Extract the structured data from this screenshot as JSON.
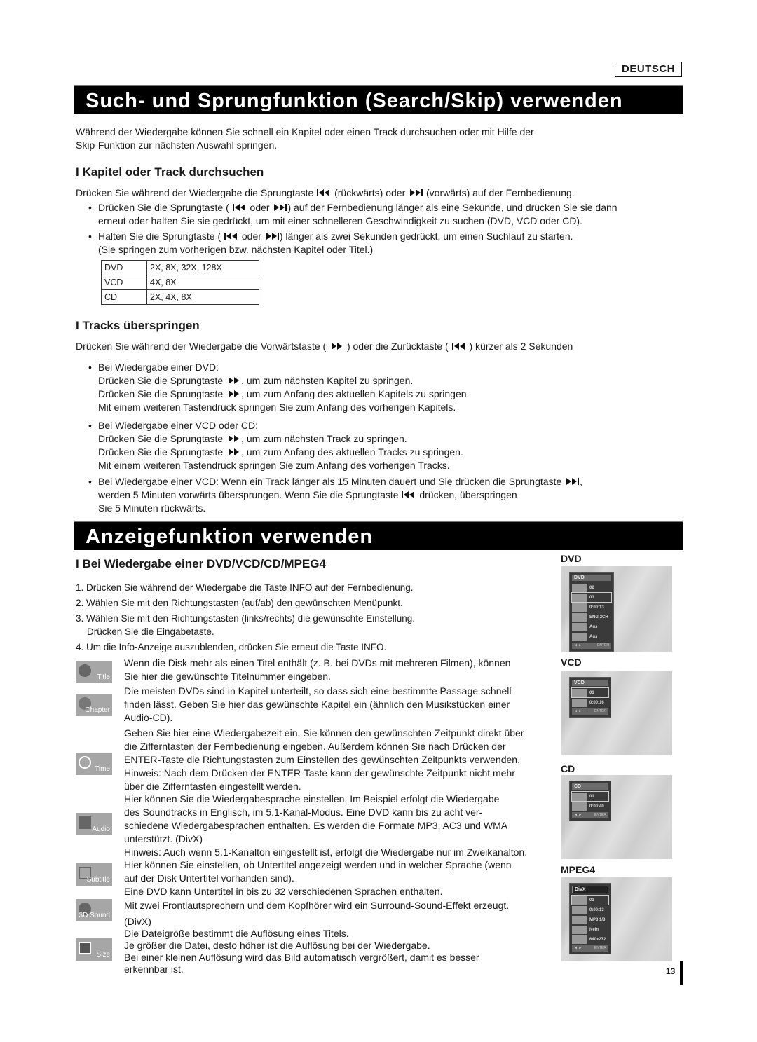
{
  "language_badge": "DEUTSCH",
  "section1": {
    "title": "Such- und Sprungfunktion (Search/Skip) verwenden",
    "intro": [
      "Während der Wiedergabe können Sie schnell ein Kapitel oder einen Track durchsuchen oder mit Hilfe der",
      "Skip-Funktion zur nächsten Auswahl springen."
    ],
    "sub1": {
      "heading": "I Kapitel oder Track durchsuchen",
      "line1_a": "Drücken Sie während der Wiedergabe die Sprungtaste",
      "line1_b": "(rückwärts) oder",
      "line1_c": "(vorwärts) auf der Fernbedienung.",
      "b1_a": "Drücken Sie die Sprungtaste (",
      "b1_b": "oder",
      "b1_c": ") auf der Fernbedienung länger als eine Sekunde, und drücken Sie sie dann",
      "b1_line2": "erneut oder halten Sie sie gedrückt, um mit einer schnelleren Geschwindigkeit zu suchen (DVD, VCD oder CD).",
      "b2_a": "Halten Sie die Sprungtaste (",
      "b2_b": "oder",
      "b2_c": ") länger als zwei Sekunden gedrückt, um einen Suchlauf zu starten.",
      "b2_line2": "(Sie springen zum vorherigen bzw. nächsten Kapitel oder Titel.)",
      "speed_table": [
        {
          "disc": "DVD",
          "speeds": "2X, 8X, 32X, 128X"
        },
        {
          "disc": "VCD",
          "speeds": "4X, 8X"
        },
        {
          "disc": "CD",
          "speeds": "2X, 4X, 8X"
        }
      ]
    },
    "sub2": {
      "heading": "I Tracks überspringen",
      "line1_a": "Drücken Sie während der Wiedergabe die Vorwärtstaste (",
      "line1_b": ") oder die Zurücktaste (",
      "line1_c": ") kürzer als 2 Sekunden",
      "dvd_head": "Bei Wiedergabe einer DVD:",
      "dvd_l1_a": "Drücken Sie die Sprungtaste",
      "dvd_l1_b": ", um zum nächsten Kapitel zu springen.",
      "dvd_l2_a": "Drücken Sie die Sprungtaste",
      "dvd_l2_b": ", um zum Anfang des aktuellen Kapitels zu springen.",
      "dvd_l3": "Mit einem weiteren Tastendruck springen Sie zum Anfang des vorherigen Kapitels.",
      "vcd_head": "Bei Wiedergabe einer VCD oder CD:",
      "vcd_l1_a": "Drücken Sie die Sprungtaste",
      "vcd_l1_b": ", um zum nächsten Track zu springen.",
      "vcd_l2_a": "Drücken Sie die Sprungtaste",
      "vcd_l2_b": ", um zum Anfang des aktuellen Tracks zu springen.",
      "vcd_l3": "Mit einem weiteren Tastendruck springen Sie zum Anfang des vorherigen Tracks.",
      "long_l1_a": "Bei Wiedergabe einer VCD: Wenn ein Track länger als 15 Minuten dauert und Sie drücken die Sprungtaste",
      "long_l1_b": ",",
      "long_l2_a": "werden 5 Minuten vorwärts übersprungen. Wenn Sie die Sprungtaste",
      "long_l2_b": "drücken, überspringen",
      "long_l3": "Sie 5 Minuten rückwärts."
    }
  },
  "section2": {
    "title": "Anzeigefunktion verwenden",
    "heading": "I Bei Wiedergabe einer DVD/VCD/CD/MPEG4",
    "steps": [
      "1. Drücken Sie während der Wiedergabe die Taste INFO auf der Fernbedienung.",
      "2. Wählen Sie mit den Richtungstasten (auf/ab) den gewünschten Menüpunkt.",
      "3. Wählen Sie mit den Richtungstasten (links/rechts) die gewünschte Einstellung.",
      "Drücken Sie die Eingabetaste.",
      "4. Um die Info-Anzeige auszublenden, drücken Sie erneut die Taste INFO."
    ],
    "items": [
      {
        "icon": "Title",
        "lines": [
          "Wenn die Disk mehr als einen Titel enthält (z. B. bei DVDs mit mehreren Filmen), können",
          "Sie hier die gewünschte Titelnummer eingeben."
        ]
      },
      {
        "icon": "Chapter",
        "lines": [
          "Die meisten DVDs sind in Kapitel unterteilt, so dass sich eine bestimmte Passage schnell",
          "finden lässt. Geben Sie hier das gewünschte Kapitel ein (ähnlich den Musikstücken einer",
          "Audio-CD)."
        ]
      },
      {
        "icon": "Time",
        "lines": [
          "Geben Sie hier eine Wiedergabezeit ein. Sie können den gewünschten Zeitpunkt direkt über",
          "die Zifferntasten der Fernbedienung eingeben. Außerdem können Sie nach Drücken der",
          "ENTER-Taste die Richtungstasten zum Einstellen des gewünschten Zeitpunkts verwenden.",
          "Hinweis: Nach dem Drücken der ENTER-Taste kann der gewünschte Zeitpunkt nicht mehr",
          "über die Zifferntasten eingestellt werden."
        ]
      },
      {
        "icon": "Audio",
        "lines": [
          "Hier können Sie die Wiedergabesprache einstellen. Im Beispiel erfolgt die Wiedergabe",
          "des Soundtracks in Englisch, im 5.1-Kanal-Modus. Eine DVD kann bis zu acht ver-",
          "schiedene Wiedergabesprachen enthalten. Es werden die Formate MP3, AC3 und WMA",
          "unterstützt. (DivX)",
          "Hinweis: Auch wenn 5.1-Kanalton eingestellt ist, erfolgt die Wiedergabe nur im Zweikanalton."
        ]
      },
      {
        "icon": "Subtitle",
        "lines": [
          "Hier können Sie einstellen, ob Untertitel angezeigt werden und in welcher Sprache (wenn",
          "auf der Disk Untertitel vorhanden sind).",
          "Eine DVD kann Untertitel in bis zu 32 verschiedenen Sprachen enthalten."
        ]
      },
      {
        "icon": "3D Sound",
        "lines": [
          "Mit zwei Frontlautsprechern und dem Kopfhörer wird ein Surround-Sound-Effekt erzeugt."
        ]
      },
      {
        "icon": "Size",
        "lines": [
          "(DivX)",
          "Die Dateigröße bestimmt die Auflösung eines Titels.",
          "Je größer die Datei, desto höher ist die Auflösung bei der Wiedergabe.",
          "Bei einer kleinen Auflösung wird das Bild automatisch vergrößert, damit es besser",
          "erkennbar ist."
        ]
      }
    ],
    "osd": [
      {
        "label": "DVD",
        "menu_title": "DVD",
        "rows": [
          {
            "icon": "Title",
            "value": "02"
          },
          {
            "icon": "Chapter",
            "value": "03"
          },
          {
            "icon": "Time",
            "value": "0:00:13"
          },
          {
            "icon": "Audio",
            "value": "ENG 2CH"
          },
          {
            "icon": "Subtitle",
            "value": "Aus"
          },
          {
            "icon": "3D Sound",
            "value": "Aus"
          }
        ],
        "footer_left": "◄ ►",
        "footer_right": "ENTER"
      },
      {
        "label": "VCD",
        "menu_title": "VCD",
        "rows": [
          {
            "icon": "Track",
            "value": "01"
          },
          {
            "icon": "Time",
            "value": "0:00:16"
          }
        ],
        "footer_left": "◄ ►",
        "footer_right": "ENTER"
      },
      {
        "label": "CD",
        "menu_title": "CD",
        "rows": [
          {
            "icon": "Track",
            "value": "01"
          },
          {
            "icon": "Time",
            "value": "0:00:40"
          }
        ],
        "footer_left": "◄ ►",
        "footer_right": "ENTER"
      },
      {
        "label": "MPEG4",
        "menu_title": "DivX",
        "rows": [
          {
            "icon": "Title",
            "value": "01"
          },
          {
            "icon": "Time",
            "value": "0:00:13"
          },
          {
            "icon": "Audio",
            "value": "MP3 1/8"
          },
          {
            "icon": "Subtitle",
            "value": "Nein"
          },
          {
            "icon": "Size",
            "value": "640x272"
          }
        ],
        "footer_left": "◄ ►",
        "footer_right": "ENTER"
      }
    ]
  },
  "page_number": "13"
}
